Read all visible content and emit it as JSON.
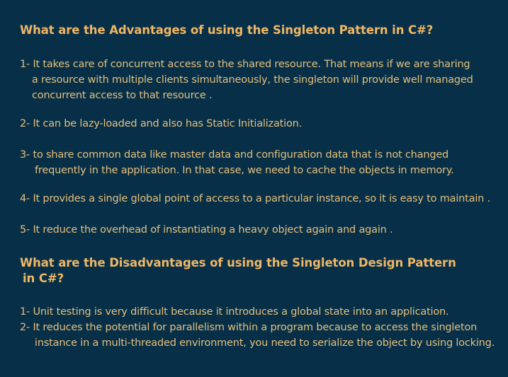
{
  "advantages": {
    "heading": "What are the Advantages of using the Singleton Pattern in C#?",
    "items": [
      {
        "lines": [
          "1- It takes care of concurrent access to the shared resource. That means if we are sharing",
          "a resource with multiple clients simultaneously, the singleton will provide  well managed",
          "concurrent access to that resource ."
        ]
      },
      {
        "lines": [
          "2- It can be lazy-loaded and also has Static Initialization."
        ]
      },
      {
        "lines": [
          "3- to share common data like master data and configuration data that is not changed",
          "frequently in the application. In that case, we need to cache the objects in memory."
        ]
      },
      {
        "lines": [
          "4- It provides a single global point of access to a particular instance, so it is easy to maintain ."
        ]
      },
      {
        "lines": [
          "5- It reduce the overhead of instantiating a heavy object again and again ."
        ]
      }
    ]
  },
  "disadvantages": {
    "heading_lines": [
      "What are the Disadvantages of using the Singleton Design Pattern",
      "in C#?"
    ],
    "items": [
      {
        "lines": [
          "1- Unit testing is very difficult because it introduces a global state into an application."
        ]
      },
      {
        "lines": [
          "2- It reduces the potential for parallelism within a program because to access the singleton",
          "instance in a multi-threaded environment, you need to serialize the object by using locking."
        ]
      }
    ]
  }
}
